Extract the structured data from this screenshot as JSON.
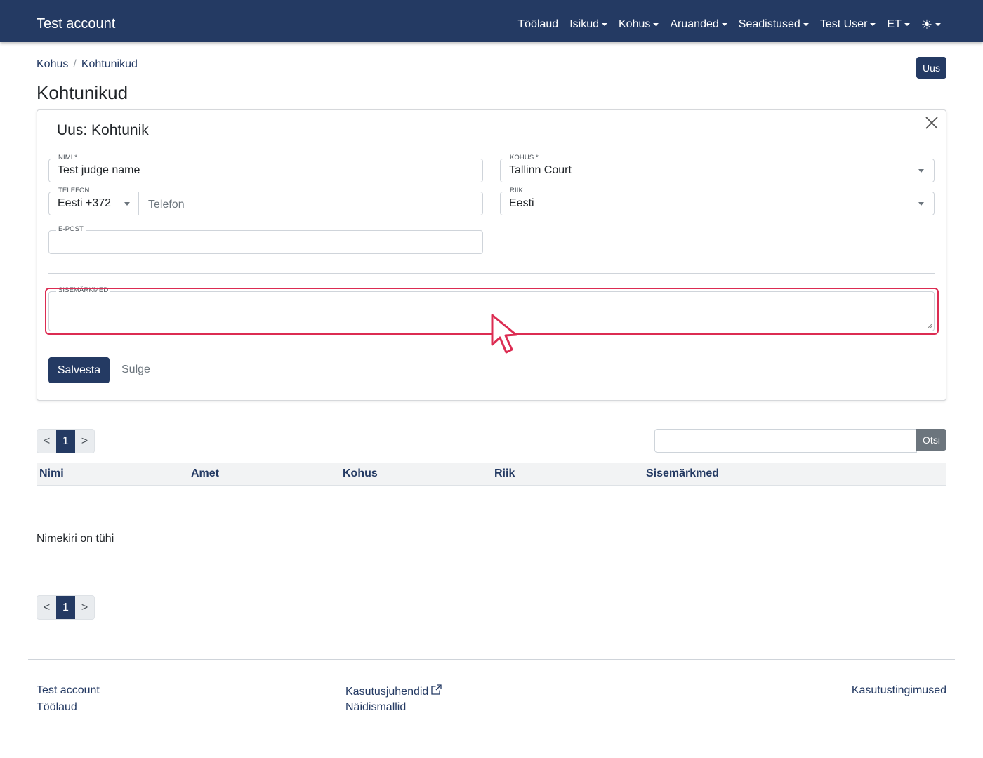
{
  "navbar": {
    "brand": "Test account",
    "items": [
      {
        "label": "Töölaud",
        "has_caret": false
      },
      {
        "label": "Isikud",
        "has_caret": true
      },
      {
        "label": "Kohus",
        "has_caret": true
      },
      {
        "label": "Aruanded",
        "has_caret": true
      },
      {
        "label": "Seadistused",
        "has_caret": true
      },
      {
        "label": "Test User",
        "has_caret": true
      },
      {
        "label": "ET",
        "has_caret": true
      }
    ],
    "theme_icon": "sun-icon",
    "color": "#243a63"
  },
  "breadcrumb": {
    "items": [
      "Kohus",
      "Kohtunikud"
    ],
    "separator": "/"
  },
  "page": {
    "title": "Kohtunikud",
    "new_button": "Uus"
  },
  "form": {
    "title": "Uus: Kohtunik",
    "close_icon": "close-icon",
    "fields": {
      "name": {
        "label": "Nimi *",
        "value": "Test judge name"
      },
      "court": {
        "label": "Kohus *",
        "value": "Tallinn Court"
      },
      "phone": {
        "label": "Telefon",
        "country_code": "Eesti +372",
        "placeholder": "Telefon"
      },
      "country": {
        "label": "Riik",
        "value": "Eesti"
      },
      "email": {
        "label": "E-post",
        "value": ""
      },
      "notes": {
        "label": "Sisemärkmed",
        "value": ""
      }
    },
    "save_button": "Salvesta",
    "close_button": "Sulge"
  },
  "list": {
    "pagination": {
      "prev": "<",
      "current": "1",
      "next": ">"
    },
    "search_button": "Otsi",
    "columns": [
      "Nimi",
      "Amet",
      "Kohus",
      "Riik",
      "Sisemärkmed"
    ],
    "empty_message": "Nimekiri on tühi"
  },
  "footer": {
    "col1": [
      "Test account",
      "Töölaud"
    ],
    "col2": [
      "Kasutusjuhendid",
      "Näidismallid"
    ],
    "col3": [
      "Kasutustingimused"
    ]
  },
  "colors": {
    "primary": "#243a63",
    "highlight": "#dc2c52",
    "secondary": "#6c757d"
  }
}
